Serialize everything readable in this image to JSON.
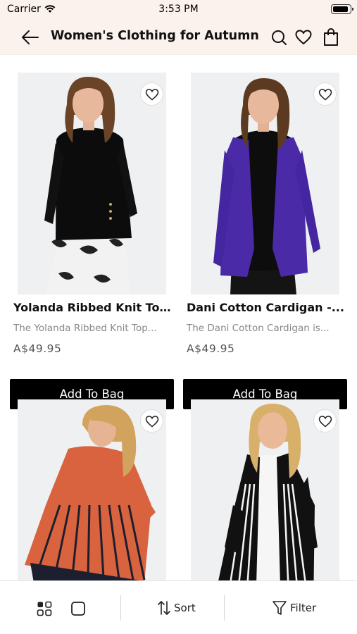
{
  "status_bar": {
    "carrier": "Carrier",
    "time": "3:53 PM"
  },
  "header": {
    "title": "Women's Clothing for Autumn"
  },
  "products": [
    {
      "name": "Yolanda Ribbed Knit Top...",
      "description": "The Yolanda Ribbed Knit Top...",
      "price": "A$49.95",
      "button": "Add To Bag"
    },
    {
      "name": "Dani Cotton Cardigan -...",
      "description": "The Dani Cotton Cardigan is...",
      "price": "A$49.95",
      "button": "Add To Bag"
    },
    {
      "name": "",
      "description": "",
      "price": "",
      "button": ""
    },
    {
      "name": "",
      "description": "",
      "price": "",
      "button": ""
    }
  ],
  "bottom_bar": {
    "sort_label": "Sort",
    "filter_label": "Filter"
  },
  "colors": {
    "header_bg": "#fbf2ee",
    "button_bg": "#000000",
    "button_text": "#ffffff",
    "purple": "#4b2aa8",
    "coral": "#d9623f"
  },
  "icons": [
    "back-arrow-icon",
    "search-icon",
    "heart-icon",
    "shopping-bag-icon",
    "grid-view-icon",
    "single-view-icon",
    "sort-icon",
    "filter-icon"
  ]
}
